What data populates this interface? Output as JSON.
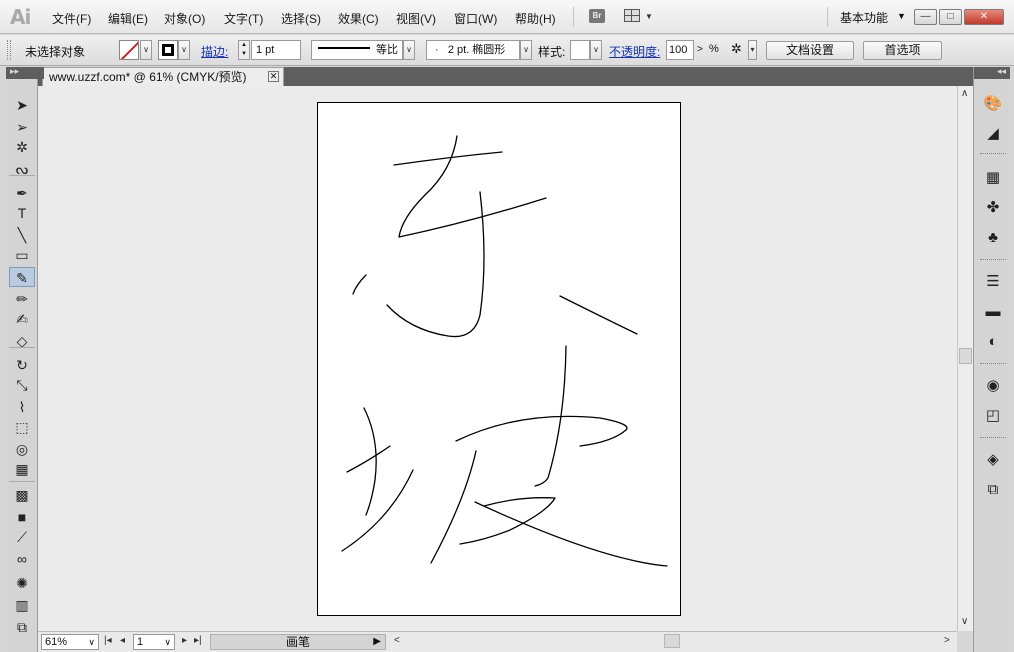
{
  "app": {
    "logo": "Ai"
  },
  "menu": [
    {
      "label": "文件(F)"
    },
    {
      "label": "编辑(E)"
    },
    {
      "label": "对象(O)"
    },
    {
      "label": "文字(T)"
    },
    {
      "label": "选择(S)"
    },
    {
      "label": "效果(C)"
    },
    {
      "label": "视图(V)"
    },
    {
      "label": "窗口(W)"
    },
    {
      "label": "帮助(H)"
    }
  ],
  "bridge_label": "Br",
  "workspace": {
    "label": "基本功能"
  },
  "window_controls": {
    "minimize": "—",
    "restore": "□",
    "close": "✕"
  },
  "control": {
    "selection_status": "未选择对象",
    "stroke_link": "描边:",
    "stroke_weight": "1 pt",
    "stroke_profile": "等比",
    "brush": "2 pt. 椭圆形",
    "brush_dot": "·",
    "style_label": "样式:",
    "opacity_link": "不透明度:",
    "opacity_value": "100",
    "opacity_unit": "%",
    "doc_settings_button": "文档设置",
    "preferences_button": "首选项",
    "fill_color": "none",
    "stroke_color": "#000000"
  },
  "document_tab": {
    "title": "www.uzzf.com* @ 61% (CMYK/预览)"
  },
  "status": {
    "zoom": "61%",
    "page": "1",
    "current_tool": "画笔"
  },
  "tools": [
    {
      "icon": "selection-tool-icon",
      "glyph": "➤"
    },
    {
      "icon": "direct-selection-tool-icon",
      "glyph": "➢"
    },
    {
      "icon": "magic-wand-tool-icon",
      "glyph": "✲"
    },
    {
      "icon": "lasso-tool-icon",
      "glyph": "ᔓ"
    },
    {
      "icon": "pen-tool-icon",
      "glyph": "✒"
    },
    {
      "icon": "type-tool-icon",
      "glyph": "T"
    },
    {
      "icon": "line-tool-icon",
      "glyph": "╲"
    },
    {
      "icon": "rectangle-tool-icon",
      "glyph": "▭"
    },
    {
      "icon": "paintbrush-tool-icon",
      "glyph": "✎"
    },
    {
      "icon": "pencil-tool-icon",
      "glyph": "✏"
    },
    {
      "icon": "blob-brush-tool-icon",
      "glyph": "✍"
    },
    {
      "icon": "eraser-tool-icon",
      "glyph": "◇"
    },
    {
      "icon": "rotate-tool-icon",
      "glyph": "↻"
    },
    {
      "icon": "scale-tool-icon",
      "glyph": "⤡"
    },
    {
      "icon": "width-tool-icon",
      "glyph": "⌇"
    },
    {
      "icon": "free-transform-tool-icon",
      "glyph": "⬚"
    },
    {
      "icon": "shape-builder-tool-icon",
      "glyph": "◎"
    },
    {
      "icon": "perspective-grid-tool-icon",
      "glyph": "▦"
    },
    {
      "icon": "mesh-tool-icon",
      "glyph": "▩"
    },
    {
      "icon": "gradient-tool-icon",
      "glyph": "■"
    },
    {
      "icon": "eyedropper-tool-icon",
      "glyph": "⟋"
    },
    {
      "icon": "blend-tool-icon",
      "glyph": "∞"
    },
    {
      "icon": "symbol-sprayer-tool-icon",
      "glyph": "✺"
    },
    {
      "icon": "column-graph-tool-icon",
      "glyph": "▥"
    },
    {
      "icon": "artboard-tool-icon",
      "glyph": "⧉"
    }
  ],
  "dock": [
    {
      "icon": "color-panel-icon",
      "glyph": "🎨"
    },
    {
      "icon": "color-guide-panel-icon",
      "glyph": "◢"
    },
    {
      "icon": "swatches-panel-icon",
      "glyph": "▦"
    },
    {
      "icon": "brushes-panel-icon",
      "glyph": "✤"
    },
    {
      "icon": "symbols-panel-icon",
      "glyph": "♣"
    },
    {
      "icon": "stroke-panel-icon",
      "glyph": "☰"
    },
    {
      "icon": "gradient-panel-icon",
      "glyph": "▬"
    },
    {
      "icon": "transparency-panel-icon",
      "glyph": "◐"
    },
    {
      "icon": "appearance-panel-icon",
      "glyph": "◉"
    },
    {
      "icon": "graphic-styles-panel-icon",
      "glyph": "◰"
    },
    {
      "icon": "layers-panel-icon",
      "glyph": "◈"
    },
    {
      "icon": "artboards-panel-icon",
      "glyph": "⧉"
    }
  ]
}
